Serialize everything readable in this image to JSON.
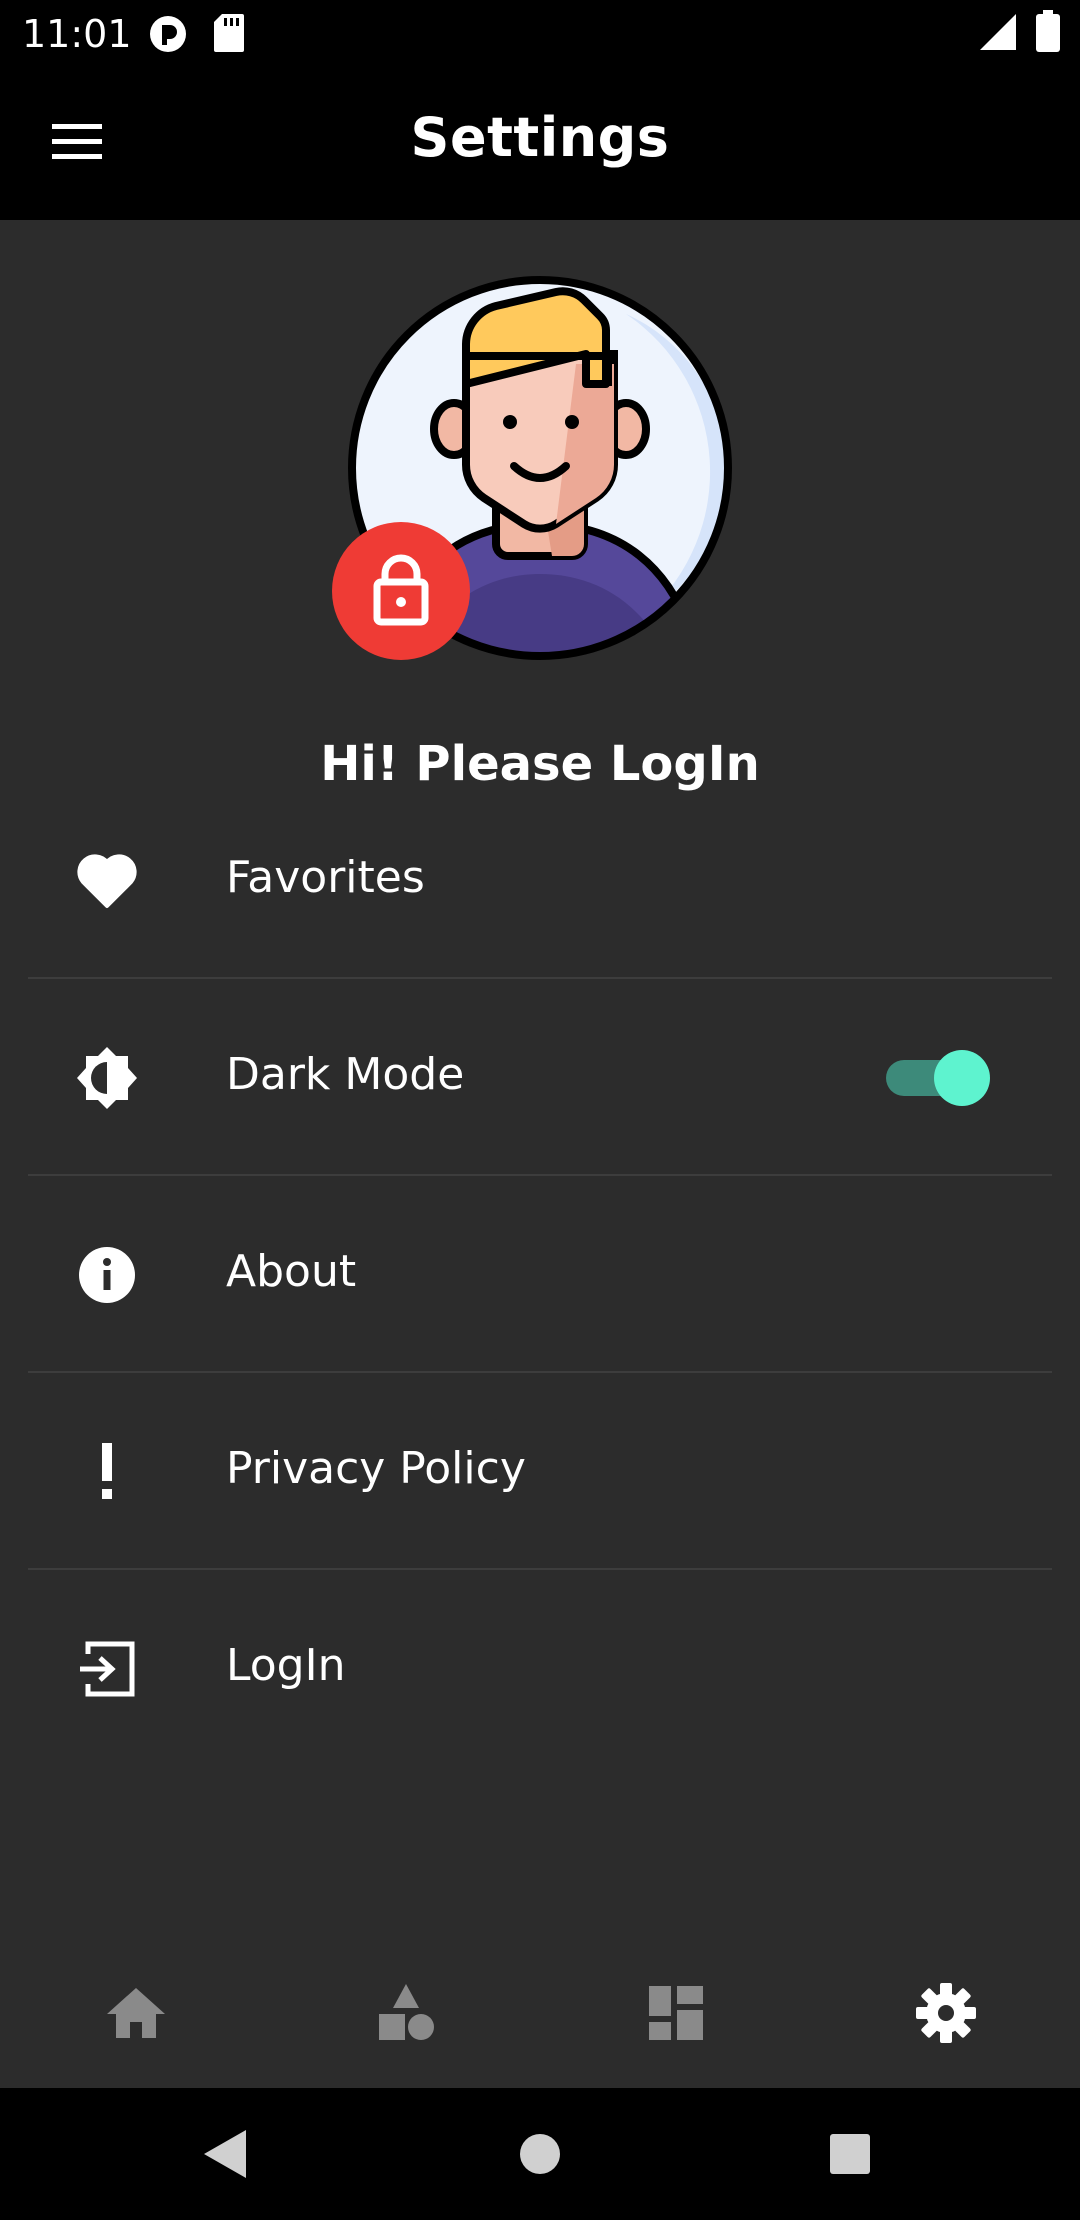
{
  "status_bar": {
    "time": "11:01",
    "icons": [
      "notification-icon",
      "sd-card-icon",
      "signal-icon",
      "battery-icon"
    ]
  },
  "app_bar": {
    "title": "Settings",
    "menu_icon": "hamburger-menu-icon"
  },
  "profile": {
    "avatar_icon": "user-avatar-icon",
    "lock_icon": "lock-icon",
    "lock_color": "#ef3b35",
    "greeting": "Hi! Please LogIn"
  },
  "settings_list": [
    {
      "label": "Favorites",
      "icon": "heart-icon"
    },
    {
      "label": "Dark Mode",
      "icon": "brightness-icon",
      "toggle": true,
      "toggle_on": true
    },
    {
      "label": "About",
      "icon": "info-icon"
    },
    {
      "label": "Privacy Policy",
      "icon": "exclamation-icon"
    },
    {
      "label": "LogIn",
      "icon": "login-icon"
    }
  ],
  "bottom_nav": [
    {
      "icon": "home-icon",
      "active": false
    },
    {
      "icon": "shapes-icon",
      "active": false
    },
    {
      "icon": "dashboard-icon",
      "active": false
    },
    {
      "icon": "gear-icon",
      "active": true
    }
  ],
  "colors": {
    "background": "#2c2c2c",
    "bar": "#000000",
    "accent_toggle": "#5ef3cf",
    "nav_inactive": "#8a8a8a"
  }
}
